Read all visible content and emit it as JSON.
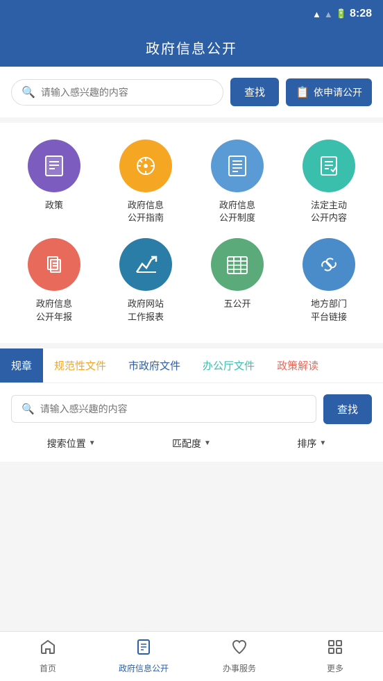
{
  "statusBar": {
    "time": "8:28"
  },
  "header": {
    "title": "政府信息公开"
  },
  "search": {
    "placeholder": "请输入感兴趣的内容",
    "searchLabel": "查找",
    "applyLabel": "依申请公开"
  },
  "iconsGrid": {
    "items": [
      {
        "id": "policy",
        "label": "政策",
        "color": "ic-purple",
        "type": "document"
      },
      {
        "id": "guide",
        "label": "政府信息\n公开指南",
        "color": "ic-orange",
        "type": "compass"
      },
      {
        "id": "system",
        "label": "政府信息\n公开制度",
        "color": "ic-blue",
        "type": "list"
      },
      {
        "id": "legal",
        "label": "法定主动\n公开内容",
        "color": "ic-teal",
        "type": "clipboard"
      },
      {
        "id": "annual",
        "label": "政府信息\n公开年报",
        "color": "ic-red",
        "type": "files"
      },
      {
        "id": "report",
        "label": "政府网站\n工作报表",
        "color": "ic-darkblue",
        "type": "chart"
      },
      {
        "id": "five",
        "label": "五公开",
        "color": "ic-green",
        "type": "calendar"
      },
      {
        "id": "local",
        "label": "地方部门\n平台链接",
        "color": "ic-lightblue",
        "type": "handshake"
      }
    ]
  },
  "tabs": {
    "items": [
      {
        "id": "rules",
        "label": "规章",
        "active": true
      },
      {
        "id": "normative",
        "label": "规范性文件",
        "active": false,
        "color": "orange"
      },
      {
        "id": "city",
        "label": "市政府文件",
        "active": false,
        "color": "blue2"
      },
      {
        "id": "office",
        "label": "办公厅文件",
        "active": false,
        "color": "green2"
      },
      {
        "id": "policy",
        "label": "政策解读",
        "active": false,
        "color": "red2"
      }
    ]
  },
  "tabSearch": {
    "placeholder": "请输入感兴趣的内容",
    "searchLabel": "查找"
  },
  "filters": [
    {
      "id": "location",
      "label": "搜索位置"
    },
    {
      "id": "match",
      "label": "匹配度"
    },
    {
      "id": "sort",
      "label": "排序"
    }
  ],
  "bottomNav": {
    "items": [
      {
        "id": "home",
        "label": "首页",
        "icon": "home",
        "active": false
      },
      {
        "id": "gov-info",
        "label": "政府信息公开",
        "icon": "document",
        "active": true
      },
      {
        "id": "services",
        "label": "办事服务",
        "icon": "heart",
        "active": false
      },
      {
        "id": "more",
        "label": "更多",
        "icon": "grid",
        "active": false
      }
    ]
  }
}
